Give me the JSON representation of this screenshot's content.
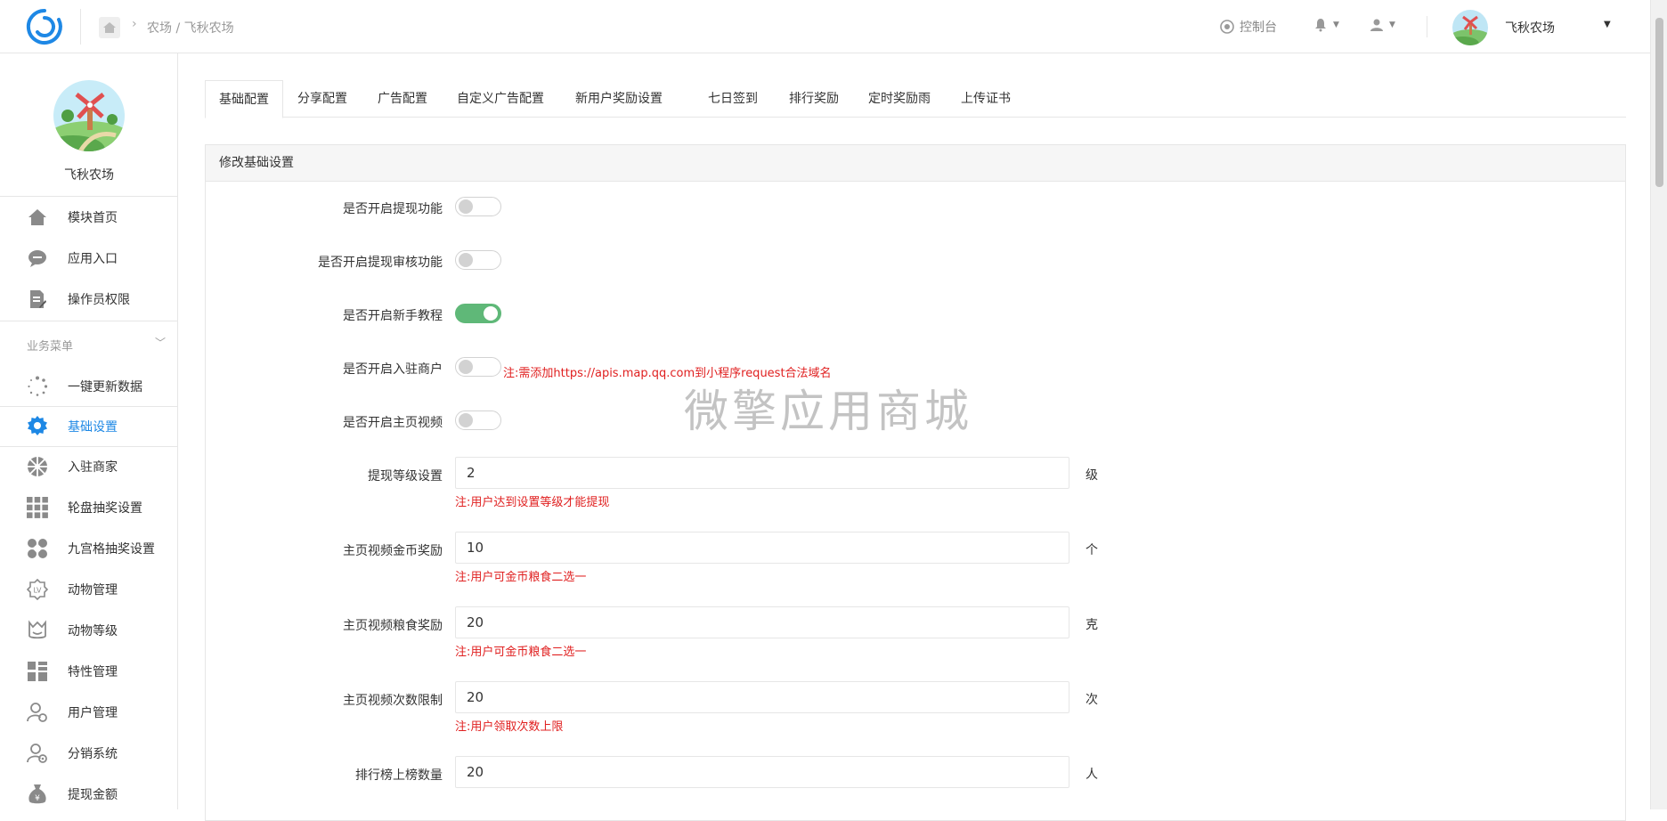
{
  "header": {
    "breadcrumb": "农场 / 飞秋农场",
    "console_label": "控制台",
    "user_name": "飞秋农场"
  },
  "sidebar": {
    "app_name": "飞秋农场",
    "top_items": [
      {
        "label": "模块首页",
        "icon": "home-icon"
      },
      {
        "label": "应用入口",
        "icon": "chat-icon"
      },
      {
        "label": "操作员权限",
        "icon": "edit-doc-icon"
      }
    ],
    "group_label": "业务菜单",
    "items": [
      {
        "label": "一键更新数据",
        "icon": "loading-icon"
      },
      {
        "label": "基础设置",
        "icon": "gear-icon",
        "active": true
      },
      {
        "label": "入驻商家",
        "icon": "wheel-icon"
      },
      {
        "label": "轮盘抽奖设置",
        "icon": "grid-icon"
      },
      {
        "label": "九宫格抽奖设置",
        "icon": "users-icon"
      },
      {
        "label": "动物管理",
        "icon": "level-icon"
      },
      {
        "label": "动物等级",
        "icon": "badge-icon"
      },
      {
        "label": "特性管理",
        "icon": "dashboard-icon"
      },
      {
        "label": "用户管理",
        "icon": "user-settings-icon"
      },
      {
        "label": "分销系统",
        "icon": "user-gear-icon"
      },
      {
        "label": "提现金额",
        "icon": "money-bag-icon"
      }
    ]
  },
  "tabs": [
    "基础配置",
    "分享配置",
    "广告配置",
    "自定义广告配置",
    "新用户奖励设置",
    "七日签到",
    "排行奖励",
    "定时奖励雨",
    "上传证书"
  ],
  "panel": {
    "title": "修改基础设置",
    "switches": [
      {
        "label": "是否开启提现功能",
        "on": false
      },
      {
        "label": "是否开启提现审核功能",
        "on": false
      },
      {
        "label": "是否开启新手教程",
        "on": true
      },
      {
        "label": "是否开启入驻商户",
        "on": false,
        "note": "注:需添加https://apis.map.qq.com到小程序request合法域名"
      },
      {
        "label": "是否开启主页视频",
        "on": false
      }
    ],
    "fields": [
      {
        "label": "提现等级设置",
        "value": "2",
        "unit": "级",
        "note": "注:用户达到设置等级才能提现"
      },
      {
        "label": "主页视频金币奖励",
        "value": "10",
        "unit": "个",
        "note": "注:用户可金币粮食二选一"
      },
      {
        "label": "主页视频粮食奖励",
        "value": "20",
        "unit": "克",
        "note": "注:用户可金币粮食二选一"
      },
      {
        "label": "主页视频次数限制",
        "value": "20",
        "unit": "次",
        "note": "注:用户领取次数上限"
      },
      {
        "label": "排行榜上榜数量",
        "value": "20",
        "unit": "人"
      }
    ]
  },
  "watermark": "微擎应用商城",
  "colors": {
    "accent": "#1e88e5",
    "switch_on": "#5fb878",
    "note": "#e02020"
  }
}
